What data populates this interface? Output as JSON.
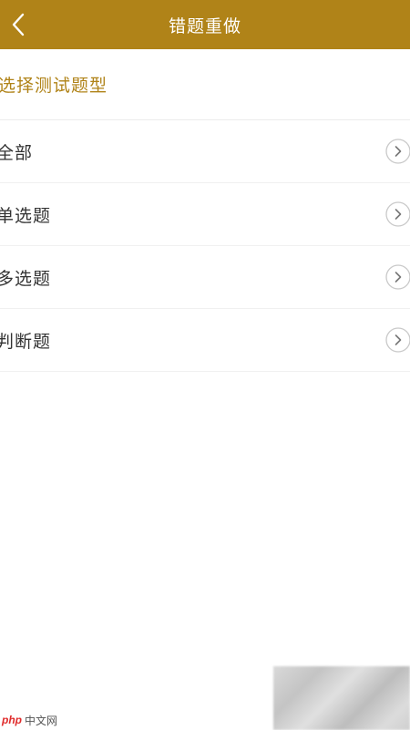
{
  "navbar": {
    "back_icon": "chevron-left-icon",
    "title": "错题重做"
  },
  "section": {
    "title": "选择测试题型"
  },
  "question_types": [
    {
      "label": "全部",
      "icon": "chevron-right-circle-icon"
    },
    {
      "label": "单选题",
      "icon": "chevron-right-circle-icon"
    },
    {
      "label": "多选题",
      "icon": "chevron-right-circle-icon"
    },
    {
      "label": "判断题",
      "icon": "chevron-right-circle-icon"
    }
  ],
  "watermark": {
    "logo_php": "php",
    "logo_text": "中文网"
  },
  "colors": {
    "accent": "#b08318",
    "text": "#333333",
    "divider": "#f0f0f0"
  }
}
